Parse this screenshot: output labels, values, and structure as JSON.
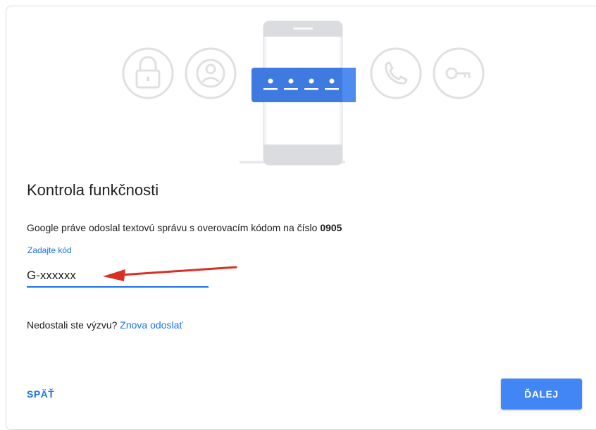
{
  "illustration": {
    "icons": [
      "lock-icon",
      "account-icon",
      "phone-icon",
      "key-icon"
    ],
    "accent_color": "#3f7ae0"
  },
  "heading": "Kontrola funkčnosti",
  "message": {
    "prefix": "Google práve odoslal textovú správu s overovacím kódom na číslo ",
    "number": "0905"
  },
  "code_field": {
    "label": "Zadajte kód",
    "value": "G-xxxxxx"
  },
  "resend": {
    "prompt": "Nedostali ste výzvu? ",
    "link": "Znova odoslať"
  },
  "buttons": {
    "back": "SPÄŤ",
    "next": "ĎALEJ"
  },
  "annotation_color": "#d93025"
}
